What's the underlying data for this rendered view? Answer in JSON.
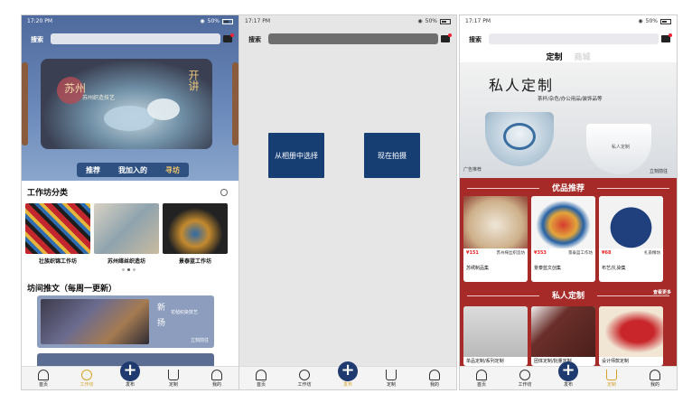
{
  "colors": {
    "navy": "#163e73",
    "gold": "#d4a32a",
    "red": "#a52a28"
  },
  "screen1": {
    "status": {
      "time": "17:20 PM",
      "battery": "50%"
    },
    "search_label": "搜索",
    "banner": {
      "title_left": "苏州",
      "subtitle": "苏州织造技艺",
      "title_right": "开讲",
      "side_text": "苏州织造"
    },
    "tabs": [
      "推荐",
      "我加入的",
      "寻坊"
    ],
    "section_title": "工作坊分类",
    "workshops": [
      {
        "label": "壮族织锦工作坊"
      },
      {
        "label": "苏州缂丝织造坊"
      },
      {
        "label": "景泰蓝工作坊"
      }
    ],
    "articles_title": "坊间推文（每周一更新）",
    "article": {
      "big_chars": "新扬",
      "text": "花毡织染技艺",
      "go": "立刻前往"
    },
    "nav": [
      "首页",
      "工作坊",
      "发布",
      "定制",
      "我的"
    ]
  },
  "screen2": {
    "status": {
      "time": "17:17 PM",
      "battery": "50%"
    },
    "search_label": "搜索",
    "btn_album": "从相册中选择",
    "btn_shoot": "现在拍摄",
    "nav": [
      "首页",
      "工作坊",
      "发布",
      "定制",
      "我的"
    ]
  },
  "screen3": {
    "status": {
      "time": "17:17 PM",
      "battery": "50%"
    },
    "search_label": "搜索",
    "top_tabs": [
      "定制",
      "商城"
    ],
    "hero": {
      "title": "私人定制",
      "subtitle": "茶杯/杂色/办公用品/装饰品等",
      "bowl_text": "私人定制",
      "ad": "广告推荐",
      "go": "立刻前往"
    },
    "sec1": "优品推荐",
    "products": [
      {
        "price": "¥151",
        "shop": "苏州缂丝织造坊",
        "name": "苏绣制品集"
      },
      {
        "price": "¥353",
        "shop": "景泰蓝工作坊",
        "name": "景泰蓝文创集"
      },
      {
        "price": "¥68",
        "shop": "扎染精坊",
        "name": "布艺/扎染集"
      }
    ],
    "more": "查看更多",
    "sec2": "私人定制",
    "custom": [
      {
        "name": "单品定制/系列定制"
      },
      {
        "name": "团体定制/批量定制"
      },
      {
        "name": "设计师款定制"
      }
    ],
    "nav": [
      "首页",
      "工作坊",
      "发布",
      "定制",
      "我的"
    ]
  }
}
